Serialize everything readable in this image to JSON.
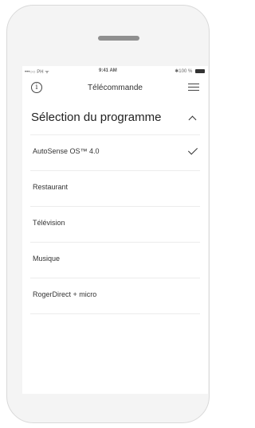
{
  "status_bar": {
    "carrier": "•••○○ PH ᯤ",
    "time": "9:41 AM",
    "battery": "✱100 %"
  },
  "nav": {
    "title": "Télécommande",
    "info_glyph": "i",
    "left_icon": "info-icon",
    "right_icon": "menu-icon"
  },
  "section": {
    "title": "Sélection du programme",
    "expanded": true
  },
  "programs": [
    {
      "label": "AutoSense OS™ 4.0",
      "selected": true
    },
    {
      "label": "Restaurant",
      "selected": false
    },
    {
      "label": "Télévision",
      "selected": false
    },
    {
      "label": "Musique",
      "selected": false
    },
    {
      "label": "RogerDirect + micro",
      "selected": false
    }
  ]
}
